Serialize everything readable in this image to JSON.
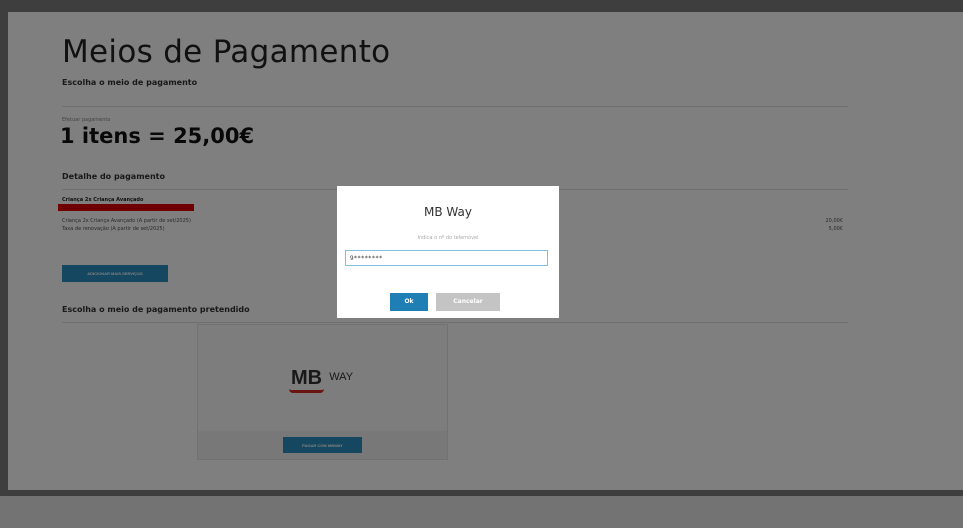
{
  "page": {
    "title": "Meios de Pagamento",
    "subtitle": "Escolha o meio de pagamento",
    "effect_label": "Efetuar pagamento",
    "total": "1 itens = 25,00€",
    "detail_heading": "Detalhe do pagamento",
    "item_title": "Criança 2x Criança Avançado",
    "lines": [
      {
        "label": "Criança 2x Criança Avançado (A partir de set/2025)",
        "price": "20,00€"
      },
      {
        "label": "Taxa de renovação (A partir de set/2025)",
        "price": "5,00€"
      }
    ],
    "add_services_label": "ADICIONAR MAIS SERVIÇOS",
    "choose_method_heading": "Escolha o meio de pagamento pretendido",
    "mbway_logo_mb": "MB",
    "mbway_logo_way": "WAY",
    "pay_with_button": "PAGAR COM MBWAY"
  },
  "modal": {
    "title": "MB Way",
    "hint": "Indica o nº do telemóvel",
    "input_value": "9********",
    "ok_label": "Ok",
    "cancel_label": "Cancelar"
  },
  "colors": {
    "accent": "#2a8fc0",
    "ok": "#1f7fb4",
    "redaction": "#e10000",
    "mb_red": "#d52b1e"
  }
}
